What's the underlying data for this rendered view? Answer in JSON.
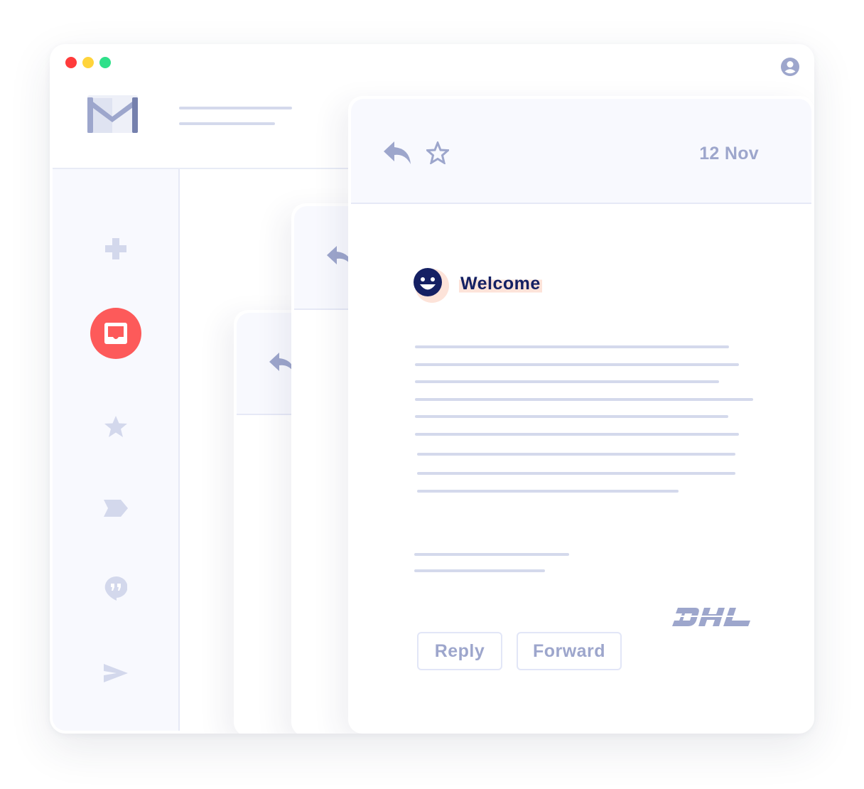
{
  "window": {
    "traffic_lights": [
      "close",
      "minimize",
      "maximize"
    ],
    "colors": {
      "close": "#ff3b3b",
      "minimize": "#ffd43b",
      "maximize": "#2fe08a"
    }
  },
  "header": {
    "logo_icon": "gmail-logo",
    "account_icon": "account-circle-icon"
  },
  "sidebar": {
    "items": [
      {
        "name": "compose",
        "icon": "plus-icon",
        "active": false
      },
      {
        "name": "inbox",
        "icon": "inbox-icon",
        "active": true
      },
      {
        "name": "starred",
        "icon": "star-icon",
        "active": false
      },
      {
        "name": "labels",
        "icon": "label-icon",
        "active": false
      },
      {
        "name": "chat",
        "icon": "chat-quote-icon",
        "active": false
      },
      {
        "name": "sent",
        "icon": "send-icon",
        "active": false
      }
    ],
    "active_color": "#fd5a5a"
  },
  "email": {
    "date": "12 Nov",
    "subject": "Welcome",
    "sender_avatar_icon": "smiley-face-icon",
    "brand_logo": "DHL",
    "actions": {
      "reply_label": "Reply",
      "forward_label": "Forward"
    }
  },
  "colors": {
    "accent": "#9da6cc",
    "subject_text": "#152063",
    "placeholder_line": "#d4d9ec",
    "highlight": "#fde3d9"
  }
}
